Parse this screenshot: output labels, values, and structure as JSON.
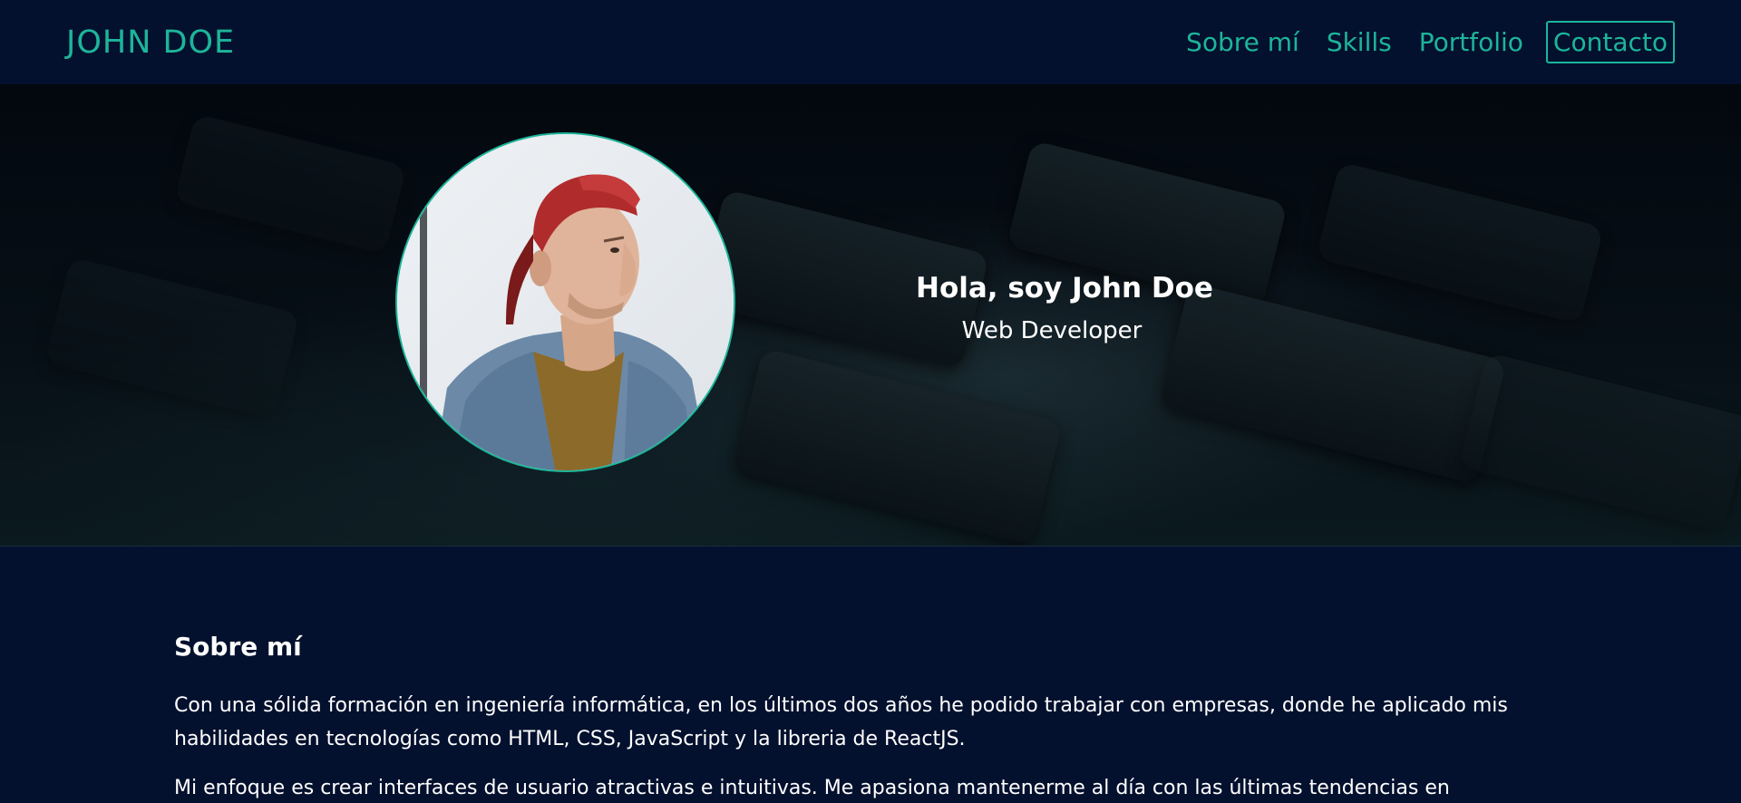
{
  "header": {
    "brand": "JOHN DOE",
    "nav": [
      {
        "label": "Sobre mí"
      },
      {
        "label": "Skills"
      },
      {
        "label": "Portfolio"
      },
      {
        "label": "Contacto"
      }
    ]
  },
  "hero": {
    "title": "Hola, soy John Doe",
    "subtitle": "Web Developer"
  },
  "about": {
    "title": "Sobre mí",
    "paragraphs": [
      "Con una sólida formación en ingeniería informática, en los últimos dos años he podido trabajar con empresas, donde he aplicado mis habilidades en tecnologías como HTML, CSS, JavaScript y la libreria de ReactJS.",
      "Mi enfoque es crear interfaces de usuario atractivas e intuitivas. Me apasiona mantenerme al día con las últimas tendencias en"
    ]
  },
  "colors": {
    "accent": "#1db59a",
    "background": "#04112e"
  }
}
